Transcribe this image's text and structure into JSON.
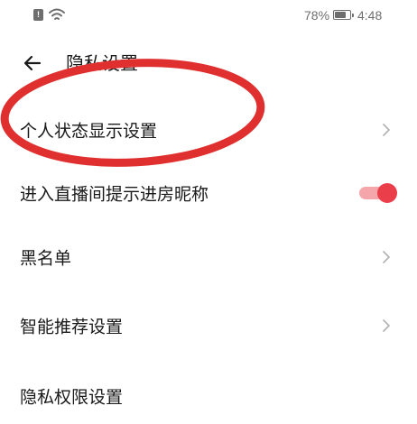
{
  "status_bar": {
    "sim_glyph": "!",
    "battery_percent": "78%",
    "battery_level": 0.78,
    "time": "4:48",
    "icons": [
      "sim-alert-icon",
      "wifi-icon",
      "battery-icon"
    ]
  },
  "header": {
    "back_icon": "arrow-left-icon",
    "title": "隐私设置"
  },
  "settings": {
    "items": [
      {
        "label": "个人状态显示设置",
        "control": "chevron-right-icon"
      },
      {
        "label": "进入直播间提示进房昵称",
        "control": "toggle",
        "toggle_on": true
      },
      {
        "label": "黑名单",
        "control": "chevron-right-icon"
      },
      {
        "label": "智能推荐设置",
        "control": "chevron-right-icon"
      },
      {
        "label": "隐私权限设置",
        "control": "chevron-right-icon"
      }
    ]
  },
  "colors": {
    "annotation_ellipse": "#e02f2f",
    "toggle_knob": "#ea3f4b",
    "toggle_track": "#f4a6aa",
    "chevron": "#b5b5b5",
    "status_text": "#6e6e6e"
  }
}
